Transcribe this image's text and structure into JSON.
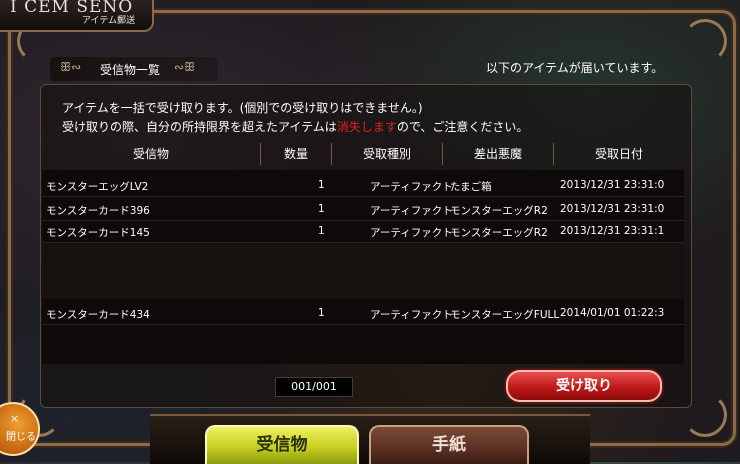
{
  "window": {
    "title": "ICEM SENO",
    "title_display": "I CEM SENO",
    "subtitle": "アイテム郵送"
  },
  "section": {
    "title": "受信物一覧",
    "ornament_left": "ꕥ∾",
    "ornament_right": "∾ꕥ"
  },
  "notice": "以下のアイテムが届いています。",
  "description": {
    "line1": "アイテムを一括で受け取ります。(個別での受け取りはできません。)",
    "line2_pre": "受け取りの際、自分の所持限界を超えたアイテムは",
    "line2_warn": "消失します",
    "line2_post": "ので、ご注意ください。"
  },
  "table": {
    "columns": [
      "受信物",
      "数量",
      "受取種別",
      "差出悪魔",
      "受取日付"
    ],
    "rows": [
      {
        "item": "モンスターエッグLV2",
        "qty": "1",
        "type": "アーティファクト",
        "sender": "たまご箱",
        "date": "2013/12/31 23:31:0"
      },
      {
        "item": "モンスターカード396",
        "qty": "1",
        "type": "アーティファクト",
        "sender": "モンスターエッグR2",
        "date": "2013/12/31 23:31:0"
      },
      {
        "item": "モンスターカード145",
        "qty": "1",
        "type": "アーティファクト",
        "sender": "モンスターエッグR2",
        "date": "2013/12/31 23:31:1"
      },
      {
        "item": "モンスターカード434",
        "qty": "1",
        "type": "アーティファクト",
        "sender": "モンスターエッグFULL",
        "date": "2014/01/01 01:22:3"
      }
    ]
  },
  "pager": "001/001",
  "receive_button": "受け取り",
  "close_button": {
    "icon": "×",
    "label": "閉じる"
  },
  "tabs": {
    "inbox": "受信物",
    "letter": "手紙"
  },
  "colors": {
    "warning": "#e02020",
    "receive_button": "#c01818",
    "active_tab": "#c8d020",
    "inactive_tab": "#5a3024"
  }
}
